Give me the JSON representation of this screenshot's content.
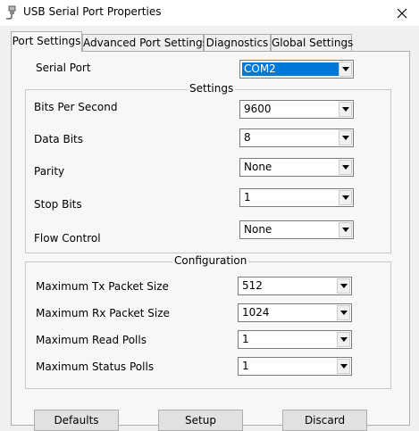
{
  "window": {
    "title": "USB Serial Port Properties",
    "close_glyph": "✕"
  },
  "tabs": [
    {
      "label": "Port Settings"
    },
    {
      "label": "Advanced Port Settings"
    },
    {
      "label": "Diagnostics"
    },
    {
      "label": "Global Settings"
    }
  ],
  "serial_port": {
    "label": "Serial Port",
    "value": "COM2"
  },
  "settings_group": {
    "title": "Settings",
    "bits_per_second": {
      "label": "Bits Per Second",
      "value": "9600"
    },
    "data_bits": {
      "label": "Data Bits",
      "value": "8"
    },
    "parity": {
      "label": "Parity",
      "value": "None"
    },
    "stop_bits": {
      "label": "Stop Bits",
      "value": "1"
    },
    "flow_control": {
      "label": "Flow Control",
      "value": "None"
    }
  },
  "configuration_group": {
    "title": "Configuration",
    "max_tx": {
      "label": "Maximum Tx Packet Size",
      "value": "512"
    },
    "max_rx": {
      "label": "Maximum Rx Packet Size",
      "value": "1024"
    },
    "max_read_polls": {
      "label": "Maximum Read Polls",
      "value": "1"
    },
    "max_status_polls": {
      "label": "Maximum Status Polls",
      "value": "1"
    }
  },
  "buttons": {
    "defaults": "Defaults",
    "setup": "Setup",
    "discard": "Discard"
  }
}
